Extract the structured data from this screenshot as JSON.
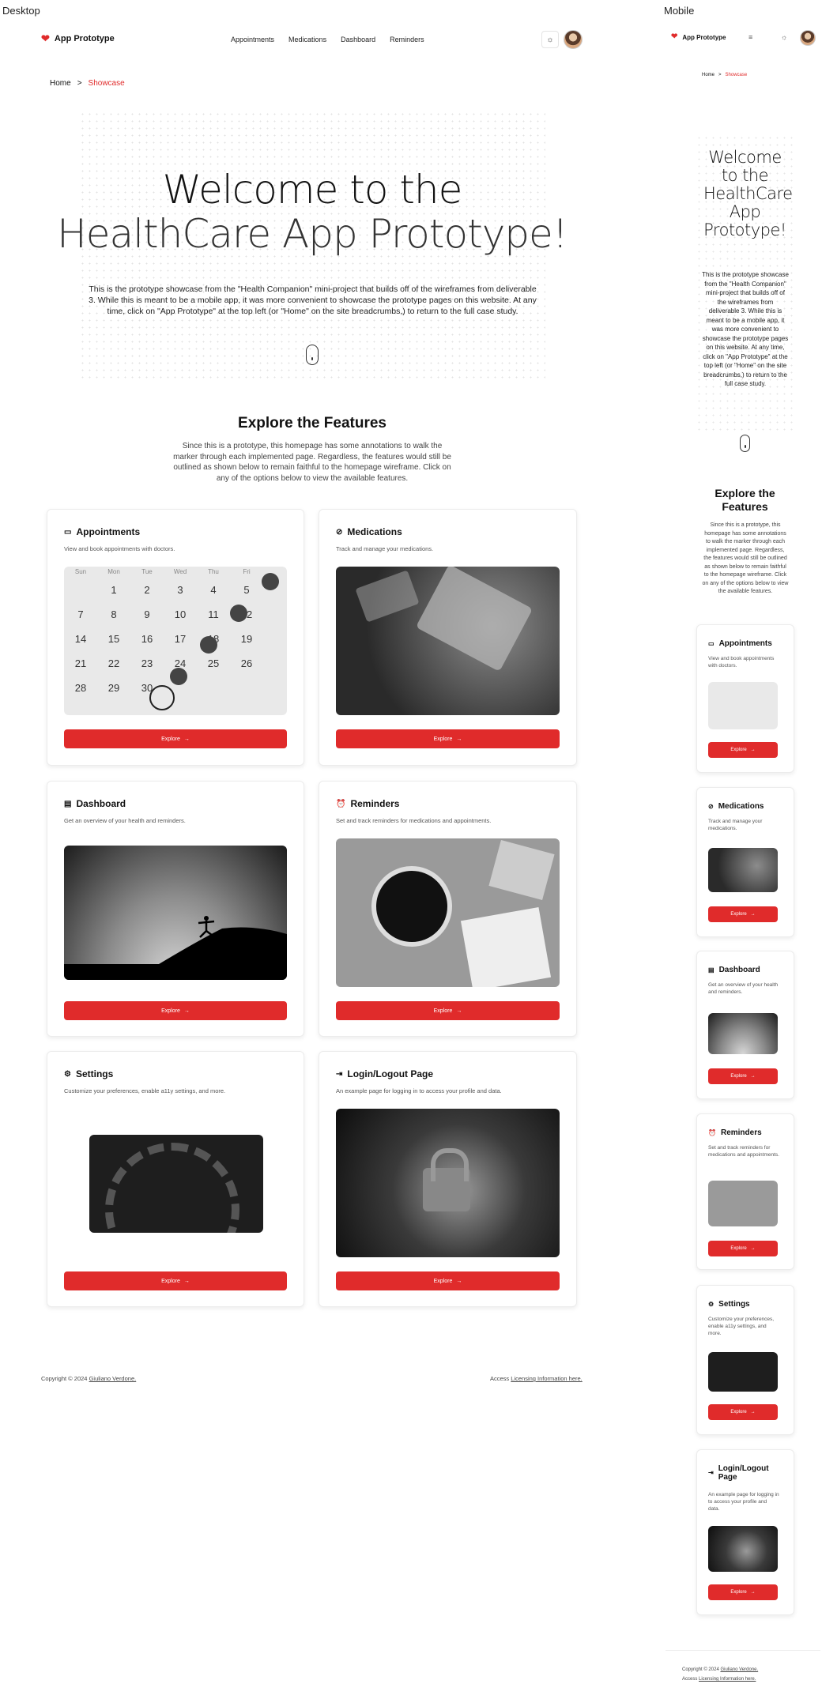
{
  "labels": {
    "desktop": "Desktop",
    "mobile": "Mobile"
  },
  "nav": {
    "logo": "App Prototype",
    "links": [
      "Appointments",
      "Medications",
      "Dashboard",
      "Reminders"
    ]
  },
  "breadcrumb": {
    "home": "Home",
    "sep": ">",
    "current": "Showcase"
  },
  "hero": {
    "title_line1": "Welcome to the",
    "title_line2": "HealthCare App Prototype!",
    "paragraph": "This is the prototype showcase from the \"Health Companion\" mini-project that builds off of the wireframes from deliverable 3. While this is meant to be a mobile app, it was more convenient to showcase the prototype pages on this website. At any time, click on \"App Prototype\" at the top left (or \"Home\" on the site breadcrumbs,) to return to the full case study."
  },
  "mobile_hero": {
    "title": "Welcome to the HealthCare App Prototype!"
  },
  "features": {
    "title": "Explore the Features",
    "paragraph": "Since this is a prototype, this homepage has some annotations to walk the marker through each implemented page. Regardless, the features would still be outlined as shown below to remain faithful to the homepage wireframe. Click on any of the options below to view the available features.",
    "cards": [
      {
        "icon": "calendar-icon",
        "title": "Appointments",
        "desc": "View and book appointments with doctors.",
        "button": "Explore"
      },
      {
        "icon": "pill-icon",
        "title": "Medications",
        "desc": "Track and manage your medications.",
        "button": "Explore"
      },
      {
        "icon": "clipboard-icon",
        "title": "Dashboard",
        "desc": "Get an overview of your health and reminders.",
        "button": "Explore"
      },
      {
        "icon": "alarm-clock-icon",
        "title": "Reminders",
        "desc": "Set and track reminders for medications and appointments.",
        "button": "Explore"
      },
      {
        "icon": "gear-icon",
        "title": "Settings",
        "desc": "Customize your preferences, enable a11y settings, and more.",
        "button": "Explore"
      },
      {
        "icon": "login-icon",
        "title": "Login/Logout Page",
        "desc": "An example page for logging in to access your profile and data.",
        "button": "Explore"
      }
    ]
  },
  "calendar": {
    "days": [
      "Sun",
      "Mon",
      "Tue",
      "Wed",
      "Thu",
      "Fri"
    ],
    "weeks": [
      [
        "",
        "1",
        "2",
        "3",
        "4",
        "5"
      ],
      [
        "7",
        "8",
        "9",
        "10",
        "11",
        "12"
      ],
      [
        "14",
        "15",
        "16",
        "17",
        "18",
        "19"
      ],
      [
        "21",
        "22",
        "23",
        "24",
        "25",
        "26"
      ],
      [
        "28",
        "29",
        "30",
        "",
        "",
        ""
      ]
    ]
  },
  "footer": {
    "copyright": "Copyright © 2024",
    "author": "Giuliano Verdone.",
    "access": "Access",
    "license": "Licensing Information here."
  },
  "colors": {
    "accent": "#e02b2b",
    "text": "#111111"
  }
}
